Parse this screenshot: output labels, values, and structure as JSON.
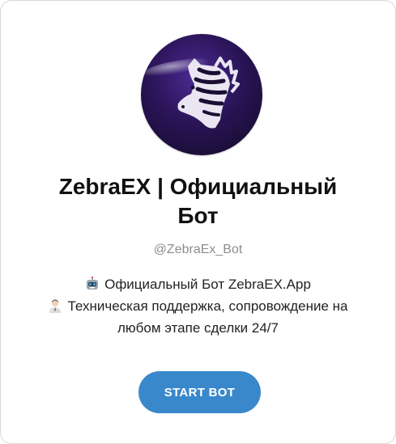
{
  "profile": {
    "avatar_icon": "zebra-logo-icon",
    "title_line1": "ZebraEX | Официальный",
    "title_line2": "Бот",
    "handle": "@ZebraEx_Bot"
  },
  "description": {
    "line1_icon": "robot-emoji-icon",
    "line1_text": "Официальный Бот ZebraEX.App",
    "line2_icon": "support-person-emoji-icon",
    "line2_text": "Техническая поддержка, сопровождение на",
    "line3_text": "любом этапе сделки 24/7"
  },
  "actions": {
    "start_label": "START BOT"
  },
  "colors": {
    "button_bg": "#3a88cc",
    "avatar_bg": "#2a1457",
    "handle_text": "#8e8e8e"
  }
}
